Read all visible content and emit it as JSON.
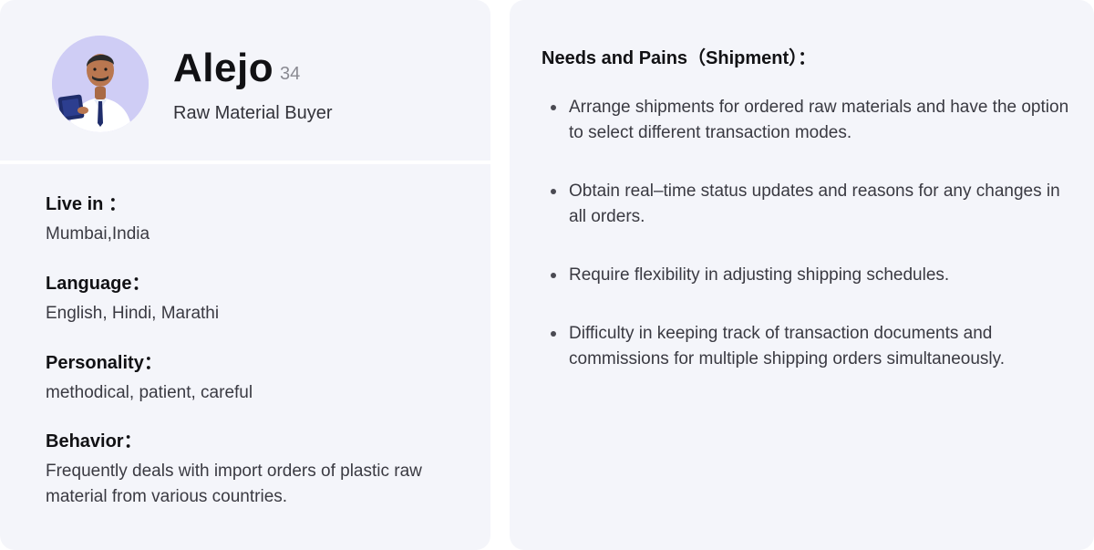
{
  "profile": {
    "name": "Alejo",
    "age": "34",
    "role": "Raw Material Buyer",
    "avatar_icon": "person-with-clipboard-icon",
    "avatar_bg": "#cfcdf5"
  },
  "details": [
    {
      "label": "Live in ：",
      "value": "Mumbai,India"
    },
    {
      "label": "Language：",
      "value": "English, Hindi, Marathi"
    },
    {
      "label": "Personality：",
      "value": "methodical, patient, careful"
    },
    {
      "label": "Behavior：",
      "value": "Frequently deals with import orders of plastic raw material from various countries."
    }
  ],
  "needs": {
    "title": "Needs and Pains（Shipment）：",
    "items": [
      "Arrange shipments for ordered raw materials and have the option to select different transaction modes.",
      "Obtain real–time status updates and reasons for any changes in all orders.",
      "Require flexibility in adjusting shipping schedules.",
      "Difficulty in keeping track of transaction documents and commissions for multiple shipping orders simultaneously."
    ]
  },
  "colors": {
    "card_bg": "#f4f5fa",
    "accent": "#cfcdf5"
  }
}
